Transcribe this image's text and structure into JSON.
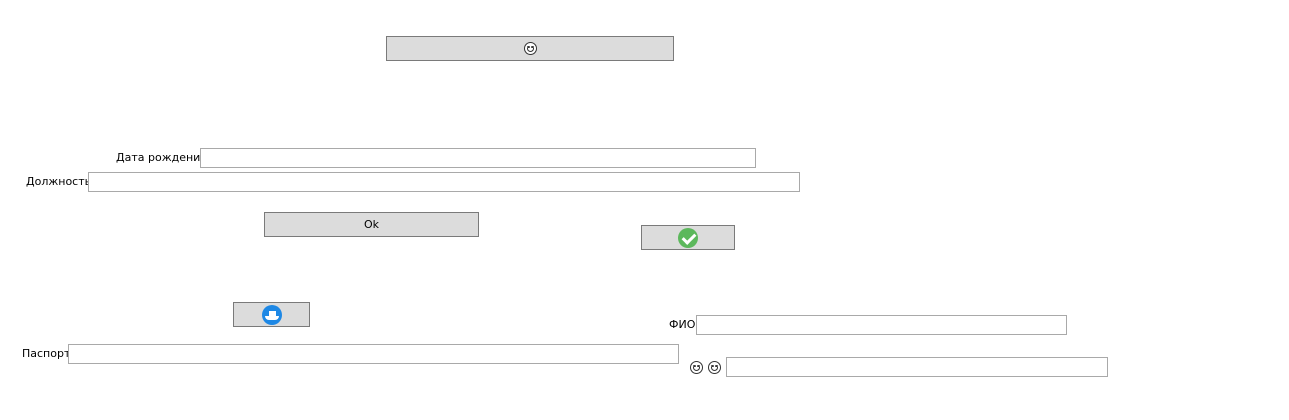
{
  "buttons": {
    "top_emoji": "laughing-face-icon",
    "ok_label": "Ok",
    "check_icon": "green-check-icon",
    "ship_icon": "blue-ship-icon"
  },
  "form": {
    "birth_date_label": "Дата рождения",
    "birth_date_value": "",
    "position_label": "Должность",
    "position_value": "",
    "fio_label": "ФИО",
    "fio_value": "",
    "passport_label": "Паспорт",
    "passport_value": "",
    "emoji_field_value": ""
  },
  "icons": {
    "emoji_label_1": "laughing-face-icon",
    "emoji_label_2": "grinning-face-icon"
  },
  "colors": {
    "button_bg": "#dcdcdc",
    "check_green": "#5cb85c",
    "ship_blue": "#1e88e5"
  }
}
